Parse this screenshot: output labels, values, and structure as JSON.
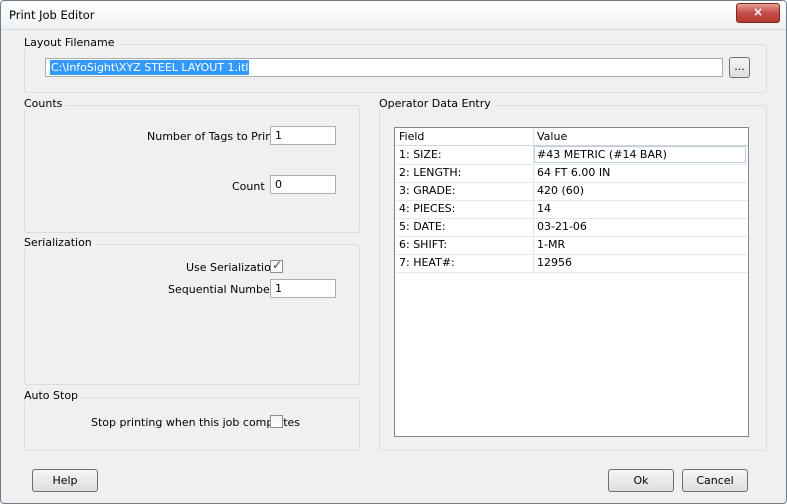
{
  "window": {
    "title": "Print Job Editor",
    "close_glyph": "×"
  },
  "layout": {
    "group_title": "Layout Filename",
    "filename": "C:\\InfoSight\\XYZ STEEL LAYOUT 1.itl",
    "browse_label": "..."
  },
  "counts": {
    "group_title": "Counts",
    "tags_label": "Number of Tags to Print :",
    "tags_value": "1",
    "count_label": "Count",
    "count_value": "0"
  },
  "serialization": {
    "group_title": "Serialization",
    "use_label": "Use Serialization",
    "use_checked": true,
    "seq_label": "Sequential Number :",
    "seq_value": "1"
  },
  "autostop": {
    "group_title": "Auto Stop",
    "stop_label": "Stop printing when this job completes",
    "stop_checked": false
  },
  "operator": {
    "group_title": "Operator Data Entry",
    "columns": [
      "Field",
      "Value"
    ],
    "rows": [
      {
        "field": "1: SIZE:",
        "value": "#43 METRIC (#14 BAR)"
      },
      {
        "field": "2: LENGTH:",
        "value": "64 FT 6.00 IN"
      },
      {
        "field": "3: GRADE:",
        "value": "420 (60)"
      },
      {
        "field": "4: PIECES:",
        "value": "14"
      },
      {
        "field": "5: DATE:",
        "value": "03-21-06"
      },
      {
        "field": "6: SHIFT:",
        "value": "1-MR"
      },
      {
        "field": "7: HEAT#:",
        "value": "12956"
      }
    ]
  },
  "buttons": {
    "help": "Help",
    "ok": "Ok",
    "cancel": "Cancel"
  },
  "icons": {
    "check": "✓"
  }
}
